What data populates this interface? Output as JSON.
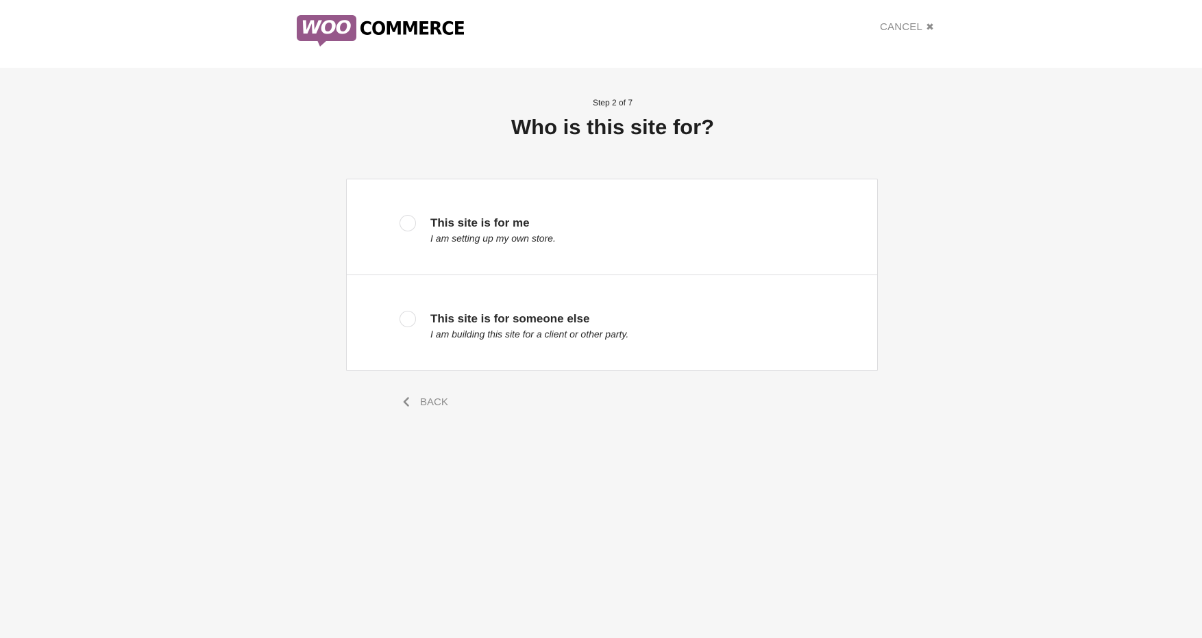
{
  "header": {
    "logo_woo": "WOO",
    "logo_commerce": "COMMERCE",
    "cancel_label": "CANCEL"
  },
  "wizard": {
    "step_text": "Step 2 of 7",
    "title": "Who is this site for?",
    "options": [
      {
        "title": "This site is for me",
        "description": "I am setting up my own store.",
        "selected": false
      },
      {
        "title": "This site is for someone else",
        "description": "I am building this site for a client or other party.",
        "selected": false
      }
    ],
    "back_label": "BACK"
  },
  "icons": {
    "close": "close-icon",
    "back": "chevron-left-icon"
  },
  "colors": {
    "brand": "#96588a",
    "background": "#f6f6f6",
    "muted": "#8c8c8c"
  }
}
